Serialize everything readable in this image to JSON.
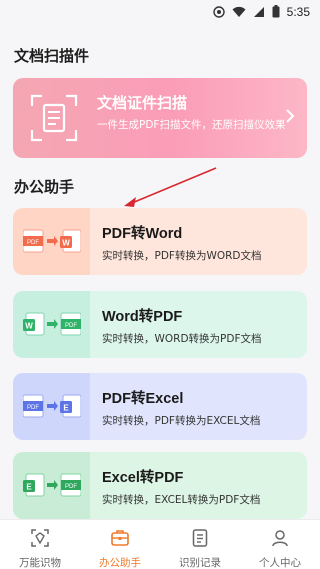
{
  "status_bar": {
    "time": "5:35"
  },
  "scan_section": {
    "title": "文档扫描件",
    "card": {
      "title": "文档证件扫描",
      "subtitle": "一件生成PDF扫描文件，还原扫描仪效果"
    }
  },
  "office_section": {
    "title": "办公助手",
    "tools": [
      {
        "title": "PDF转Word",
        "subtitle": "实时转换，PDF转换为WORD文档",
        "from": "PDF",
        "to": "W"
      },
      {
        "title": "Word转PDF",
        "subtitle": "实时转换，WORD转换为PDF文档",
        "from": "W",
        "to": "PDF"
      },
      {
        "title": "PDF转Excel",
        "subtitle": "实时转换，PDF转换为EXCEL文档",
        "from": "PDF",
        "to": "E"
      },
      {
        "title": "Excel转PDF",
        "subtitle": "实时转换，EXCEL转换为PDF文档",
        "from": "E",
        "to": "PDF"
      }
    ]
  },
  "tabbar": {
    "active_index": 1,
    "tabs": [
      {
        "label": "万能识物",
        "icon": "scan-object-icon"
      },
      {
        "label": "办公助手",
        "icon": "briefcase-icon"
      },
      {
        "label": "识别记录",
        "icon": "record-list-icon"
      },
      {
        "label": "个人中心",
        "icon": "person-icon"
      }
    ]
  },
  "colors": {
    "accent": "#f07a2c",
    "annotation_arrow": "#d9282f",
    "pdf_red": "#f26b4d",
    "word_blue": "#3a8fe6",
    "excel_green": "#2fb368"
  }
}
